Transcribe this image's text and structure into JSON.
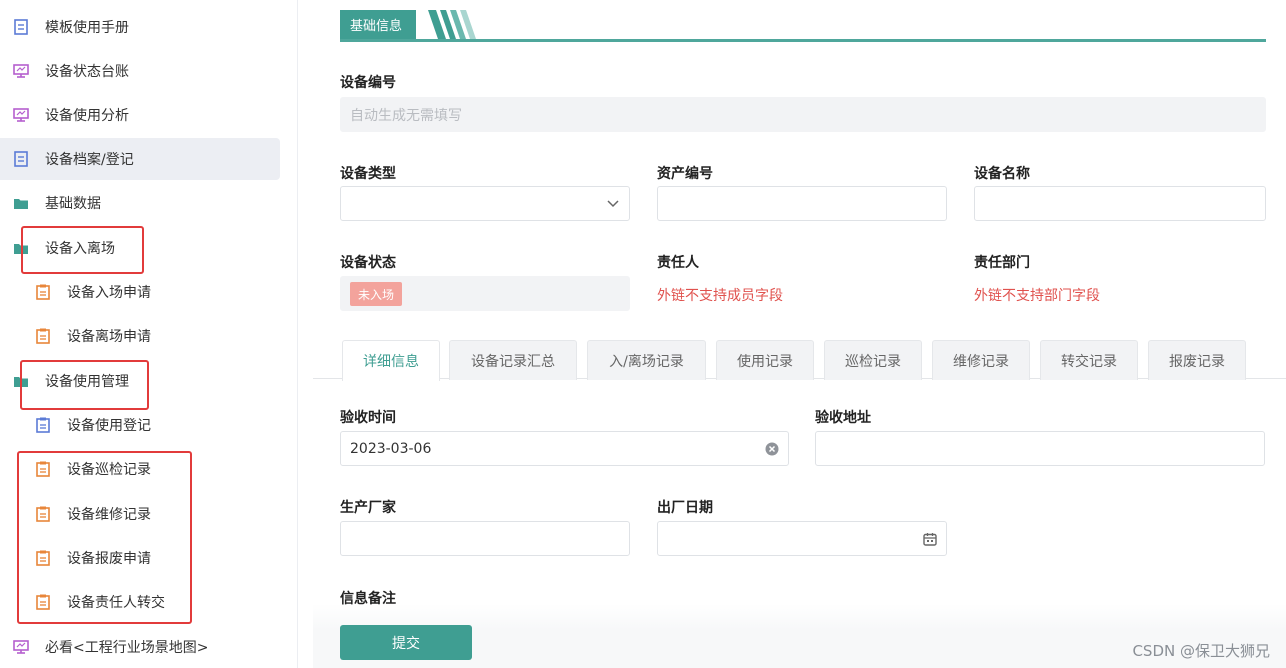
{
  "sidebar": {
    "items": [
      {
        "label": "模板使用手册",
        "icon": "document-icon"
      },
      {
        "label": "设备状态台账",
        "icon": "monitor-icon"
      },
      {
        "label": "设备使用分析",
        "icon": "monitor-icon"
      },
      {
        "label": "设备档案/登记",
        "icon": "document-icon"
      },
      {
        "label": "基础数据",
        "icon": "folder-icon"
      },
      {
        "label": "设备入离场",
        "icon": "folder-icon"
      },
      {
        "label": "设备入场申请",
        "icon": "clipboard-icon"
      },
      {
        "label": "设备离场申请",
        "icon": "clipboard-icon"
      },
      {
        "label": "设备使用管理",
        "icon": "folder-icon"
      },
      {
        "label": "设备使用登记",
        "icon": "clipboard-icon"
      },
      {
        "label": "设备巡检记录",
        "icon": "clipboard-icon"
      },
      {
        "label": "设备维修记录",
        "icon": "clipboard-icon"
      },
      {
        "label": "设备报废申请",
        "icon": "clipboard-icon"
      },
      {
        "label": "设备责任人转交",
        "icon": "clipboard-icon"
      },
      {
        "label": "必看<工程行业场景地图>",
        "icon": "monitor-icon"
      }
    ],
    "active_label": "设备档案/登记"
  },
  "section": {
    "title": "基础信息"
  },
  "form": {
    "device_no": {
      "label": "设备编号",
      "placeholder": "自动生成无需填写"
    },
    "device_type": {
      "label": "设备类型",
      "value": ""
    },
    "asset_no": {
      "label": "资产编号",
      "value": ""
    },
    "device_name": {
      "label": "设备名称",
      "value": ""
    },
    "device_status": {
      "label": "设备状态",
      "value": "未入场"
    },
    "owner": {
      "label": "责任人",
      "value": "外链不支持成员字段"
    },
    "department": {
      "label": "责任部门",
      "value": "外链不支持部门字段"
    }
  },
  "tabs": [
    "详细信息",
    "设备记录汇总",
    "入/离场记录",
    "使用记录",
    "巡检记录",
    "维修记录",
    "转交记录",
    "报废记录"
  ],
  "detail": {
    "accept_time": {
      "label": "验收时间",
      "value": "2023-03-06"
    },
    "accept_address": {
      "label": "验收地址",
      "value": ""
    },
    "manufacturer": {
      "label": "生产厂家",
      "value": ""
    },
    "factory_date": {
      "label": "出厂日期",
      "value": ""
    },
    "remarks": {
      "label": "信息备注"
    }
  },
  "submit_label": "提交",
  "watermark": "CSDN @保卫大狮兄",
  "colors": {
    "accent": "#3f9e92",
    "highlight_box": "#e23b3b",
    "warning_text": "#e0524e"
  }
}
